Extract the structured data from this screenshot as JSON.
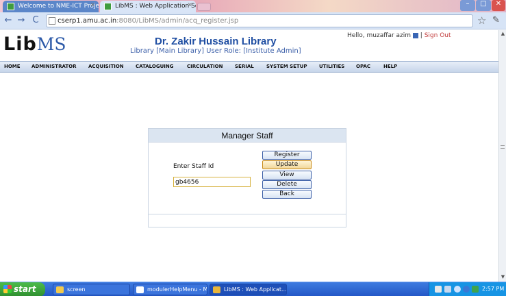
{
  "browser": {
    "tabs": [
      {
        "label": "Welcome to NME-ICT Project"
      },
      {
        "label": "LibMS : Web Application Secti"
      }
    ],
    "url_host": "cserp1.amu.ac.in",
    "url_rest": ":8080/LibMS/admin/acq_register.jsp"
  },
  "header": {
    "logo_main": "Lib",
    "logo_accent": "MS",
    "library_title": "Dr. Zakir Hussain Library",
    "library_role": "Library [Main Library]  User Role: [Institute Admin]",
    "greeting": "Hello,  muzaffar azim",
    "separator": "|",
    "signout": "Sign Out"
  },
  "menu": [
    "HOME",
    "ADMINISTRATOR",
    "ACQUISITION",
    "CATALOGUING",
    "CIRCULATION",
    "SERIAL",
    "SYSTEM SETUP",
    "UTILITIES",
    "OPAC",
    "HELP"
  ],
  "panel": {
    "title": "Manager Staff",
    "staff_label": "Enter Staff Id",
    "staff_value": "gb4656",
    "buttons": [
      "Register",
      "Update",
      "View",
      "Delete",
      "Back"
    ],
    "active_button": "Update"
  },
  "taskbar": {
    "start": "start",
    "items": [
      "screen",
      "modulerHelpMenu - M...",
      "LibMS : Web Applicat..."
    ],
    "clock": "2:57 PM"
  },
  "colors": {
    "accent": "#1f4ea2",
    "signout": "#c23b3b",
    "input_border": "#d6b03c"
  },
  "icons": [
    "page-icon",
    "star-icon",
    "wrench-icon",
    "user-icon",
    "back-arrow-icon",
    "forward-arrow-icon",
    "reload-icon"
  ]
}
